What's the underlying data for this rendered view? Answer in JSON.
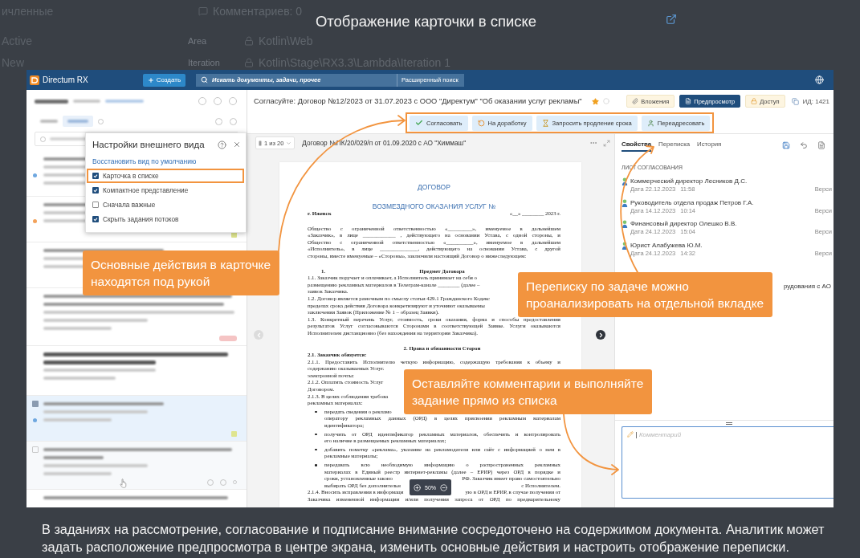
{
  "background_page": {
    "rows": [
      {
        "kind": "comments",
        "status": "ичленные",
        "value": "Комментариев: 0"
      },
      {
        "kind": "path",
        "status": "Active",
        "field": "Area",
        "value": "Kotlin\\Web"
      },
      {
        "kind": "path",
        "status": "New",
        "field": "Iteration",
        "value": "Kotlin\\Stage\\RX3.3\\Lambda\\Iteration 1"
      }
    ]
  },
  "dialog": {
    "title": "Отображение карточки в списке"
  },
  "app": {
    "header": {
      "brand": "Directum RX",
      "create_button": "Создать",
      "search": {
        "placeholder": "Искать документы, задачи, прочее",
        "advanced_link": "Расширенный поиск"
      }
    },
    "task_list": {
      "items": [
        {
          "kind": "reply",
          "selected": false,
          "hovered": false,
          "unread": false,
          "badge": false,
          "mark": false,
          "color": "#6fa8e0"
        },
        {
          "kind": "task",
          "selected": false,
          "hovered": false,
          "unread": false,
          "badge": false,
          "mark": true,
          "color": "#f3a25a"
        },
        {
          "kind": "task",
          "selected": false,
          "hovered": false,
          "unread": false,
          "badge": false,
          "mark": false
        },
        {
          "kind": "long_reply",
          "selected": false,
          "hovered": false,
          "unread": false,
          "badge": true,
          "mark": false
        },
        {
          "kind": "notice",
          "selected": false,
          "hovered": false,
          "unread": true,
          "badge": false,
          "mark": false
        },
        {
          "kind": "task",
          "selected": true,
          "hovered": false,
          "unread": false,
          "badge": false,
          "mark": true,
          "color": "#6fa8e0"
        },
        {
          "kind": "long_task",
          "selected": false,
          "hovered": true,
          "unread": false,
          "badge": false,
          "mark": false
        },
        {
          "kind": "partial",
          "selected": false,
          "hovered": false,
          "unread": false,
          "badge": false,
          "mark": false
        }
      ]
    },
    "settings_popup": {
      "title": "Настройки внешнего вида",
      "reset_link": "Восстановить вид по умолчанию",
      "options": [
        {
          "label": "Карточка в списке",
          "checked": true,
          "highlighted": true
        },
        {
          "label": "Компактное представление",
          "checked": true,
          "highlighted": false
        },
        {
          "label": "Сначала важные",
          "checked": false,
          "highlighted": false
        },
        {
          "label": "Скрыть задания потоков",
          "checked": true,
          "highlighted": false
        }
      ]
    },
    "card": {
      "title": "Согласуйте: Договор №12/2023 от 31.07.2023 с ООО \"Директум\" \"Об оказании услуг рекламы\"",
      "starred": true,
      "tool_buttons": [
        {
          "kind": "attachments",
          "label": "Вложения",
          "selected": false
        },
        {
          "kind": "preview",
          "label": "Предпросмотр",
          "selected": true
        },
        {
          "kind": "access",
          "label": "Доступ",
          "selected": false
        }
      ],
      "id_label": "ИД: 1421",
      "actions_highlighted": true,
      "actions": [
        {
          "kind": "approve",
          "label": "Согласовать"
        },
        {
          "kind": "rework",
          "label": "На доработку"
        },
        {
          "kind": "extend",
          "label": "Запросить продление срока"
        },
        {
          "kind": "forward",
          "label": "Переадресовать"
        }
      ]
    },
    "preview": {
      "pager": "1 из 20",
      "document_name": "Договор №ПК/20/029/п от 01.09.2020 с АО \"Химмаш\"",
      "zoom": "50%",
      "lines": [
        {
          "kind": "title",
          "text": "ДОГОВОР"
        },
        {
          "kind": "subtitle",
          "text": "ВОЗМЕЗДНОГО ОКАЗАНИЯ УСЛУГ №"
        },
        {
          "kind": "split",
          "left": "г. Ижевск",
          "right": "«__» ________ 2023 г."
        },
        {
          "kind": "line",
          "text": "Общество с ограниченной ответственностью «_________», именуемое в дальнейшем"
        },
        {
          "kind": "line",
          "text": "«Заказчик», в лице ____________ , действующего на основании Устава, с одной стороны, и"
        },
        {
          "kind": "line",
          "text": "Общество с ограниченной ответственностью «__________», именуемое в дальнейшем"
        },
        {
          "kind": "line",
          "text": "«Исполнитель», в лице ______________, действующего на основании Устава, с другой"
        },
        {
          "kind": "end",
          "text": "стороны, вместе именуемые – «Стороны», заключили настоящий Договор о нижеследующем:"
        },
        {
          "kind": "section",
          "number": "1.",
          "text": "Предмет Договора"
        },
        {
          "kind": "end",
          "text": "1.1. Заказчик поручает и оплачивает, а Исполнитель принимает на себя о"
        },
        {
          "kind": "end",
          "text": "размещению рекламных материалов в Телеграм-канале ________ (далее –"
        },
        {
          "kind": "end",
          "text": "заявок Заказчика."
        },
        {
          "kind": "end",
          "text": "1.2. Договор является рамочным по смыслу статьи 429.1 Гражданского Кодекс"
        },
        {
          "kind": "end",
          "text": "пределах срока действия Договора конкретизируют и уточняют оказываемы"
        },
        {
          "kind": "end",
          "text": "заключения Заявок (Приложение № 1 – образец Заявки)."
        },
        {
          "kind": "line",
          "text": "1.3. Конкретный перечень Услуг, стоимость, сроки оказания, форма и способы предоставления"
        },
        {
          "kind": "line",
          "text": "результатов Услуг согласовываются Сторонами в соответствующей Заявке. Услуги оказываются"
        },
        {
          "kind": "end",
          "text": "Исполнителем дистанционно (без нахождения на территории Заказчика)."
        },
        {
          "kind": "section",
          "text": "2. Права и обязанности Сторон"
        },
        {
          "kind": "bold",
          "text": "2.1. Заказчик обязуется:"
        },
        {
          "kind": "line",
          "text": "2.1.1. Предоставить Исполнителю четкую информацию, содержащую требования к объему и"
        },
        {
          "kind": "end",
          "text": "содержанию оказываемых Услуг."
        },
        {
          "kind": "end",
          "text": "электронной почты:"
        },
        {
          "kind": "end",
          "text": "2.1.2. Оплатить стоимость Услуг"
        },
        {
          "kind": "end",
          "text": "Договором."
        },
        {
          "kind": "end",
          "text": "2.1.3. В целях соблюдения требова"
        },
        {
          "kind": "end",
          "text": "рекламных материалах:"
        },
        {
          "kind": "bullet_end",
          "text": "передать сведения о рекламо"
        },
        {
          "kind": "indent",
          "text": "оператору рекламных данных (ОРД) в целях присвоения рекламным материалам"
        },
        {
          "kind": "indent_end",
          "text": "идентификатора;"
        },
        {
          "kind": "bullet",
          "text": "получить от ОРД идентификатор рекламных материалов, обеспечить и контролировать"
        },
        {
          "kind": "indent_end",
          "text": "его наличие в размещаемых рекламных материалах;"
        },
        {
          "kind": "bullet",
          "text": "добавить пометку «реклама», указание на рекламодателя или сайт с информацией о нем в"
        },
        {
          "kind": "indent_end",
          "text": "рекламные материалы;"
        },
        {
          "kind": "bullet",
          "text": "передавать всю необходимую информацию о распространенных рекламных"
        },
        {
          "kind": "indent",
          "text": "материалах в Единый реестр интернет-рекламы (далее – ЕРИР) через ОРД в порядке и"
        },
        {
          "kind": "indent_gap",
          "left": "сроки, установленные законо",
          "right": "РФ. Заказчик имеет право самостоятельно"
        },
        {
          "kind": "indent_gap",
          "left": "выбирать ОРД без дополнительн",
          "right": "с Исполнителем."
        },
        {
          "kind": "gap",
          "left": "2.1.4. Вносить исправления в информаци",
          "right": "ую в ОРД и ЕРИР, в случае получения от"
        },
        {
          "kind": "line",
          "text": "Заказчика измененной информации и/или получения запроса от ОРД по предварительному"
        }
      ]
    },
    "side_panel": {
      "tabs": [
        {
          "label": "Свойства",
          "selected": true
        },
        {
          "label": "Переписка",
          "selected": false
        },
        {
          "label": "История",
          "selected": false
        }
      ],
      "section_title": "ЛИСТ СОГЛАСОВАНИЯ",
      "approvals": [
        {
          "name": "Коммерческий директор Лесников Д.С.",
          "date": "Дата 22.12.2023",
          "time": "11:58",
          "version": "Верси"
        },
        {
          "name": "Руководитель отдела продаж Петров Г.А.",
          "date": "Дата 14.12.2023",
          "time": "10:14",
          "version": "Верси"
        },
        {
          "name": "Финансовый директор Олешко В.В.",
          "date": "Дата 24.12.2023",
          "time": "15:04",
          "version": "Верси"
        },
        {
          "name": "Юрист Алабужева Ю.М.",
          "date": "Дата 24.12.2023",
          "time": "14:32",
          "version": "Верси"
        }
      ],
      "related_fragment": "рудования с АО",
      "comment": {
        "placeholder": "Комментарий"
      }
    }
  },
  "callouts": [
    {
      "lines": [
        "Основные действия в карточке",
        "находятся под рукой"
      ]
    },
    {
      "lines": [
        "Переписку по задаче можно",
        "проанализировать на отдельной вкладке"
      ]
    },
    {
      "lines": [
        "Оставляйте комментарии и выполняйте",
        "задание прямо из списка"
      ]
    }
  ],
  "caption": {
    "lines": [
      "В заданиях на рассмотрение, согласование и подписание внимание сосредоточено на содержимом документа. Аналитик может",
      "задать расположение предпросмотра в центре экрана, изменить основные действия и настроить отображение переписки."
    ]
  }
}
